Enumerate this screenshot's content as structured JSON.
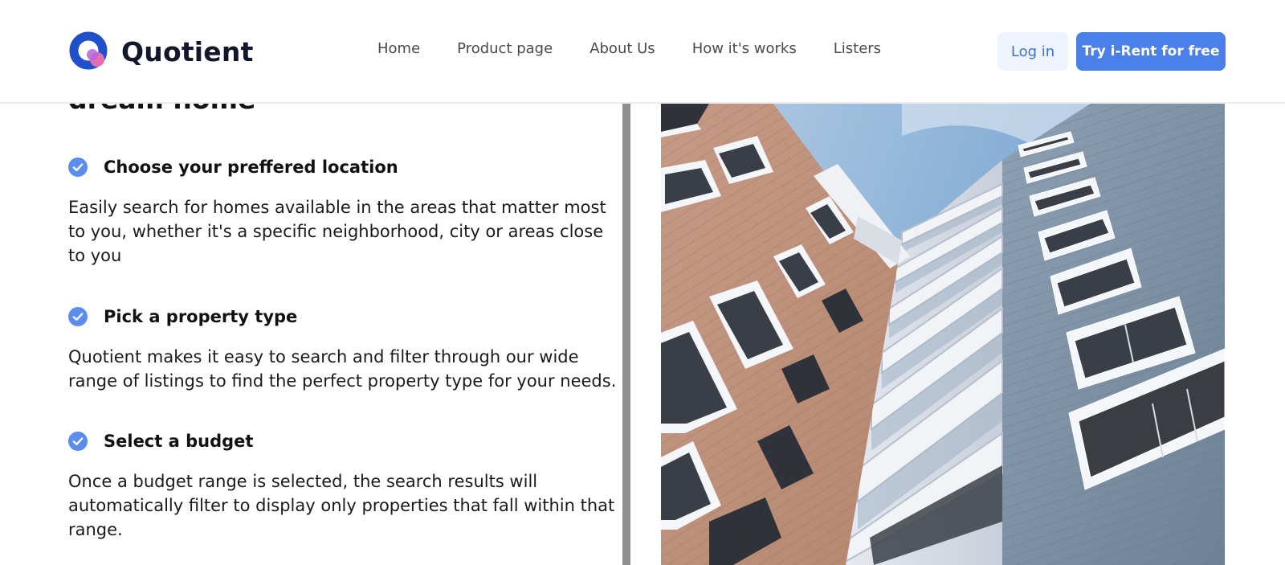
{
  "header": {
    "brand": "Quotient",
    "nav": [
      "Home",
      "Product page",
      "About Us",
      "How it's works",
      "Listers"
    ],
    "login_label": "Log in",
    "cta_label": "Try i-Rent for free"
  },
  "main": {
    "heading_partial": "dream home",
    "features": [
      {
        "title": "Choose your preffered location",
        "description": "Easily search for homes available in the areas that matter most to you, whether it's a specific neighborhood, city or areas close to you"
      },
      {
        "title": "Pick a property type",
        "description": "Quotient makes it easy to search and filter through our wide range of listings to find the perfect property type for your needs."
      },
      {
        "title": "Select a budget",
        "description": "Once a budget range is selected, the search results will automatically filter to display only properties that fall within that range."
      }
    ]
  },
  "colors": {
    "brand_blue": "#1f4fc9",
    "brand_pink": "#f06fb0",
    "accent": "#4a80e8",
    "check": "#5b8def"
  },
  "icons": {
    "feature_bullet": "check-circle-icon",
    "logo": "quotient-logo-icon"
  }
}
